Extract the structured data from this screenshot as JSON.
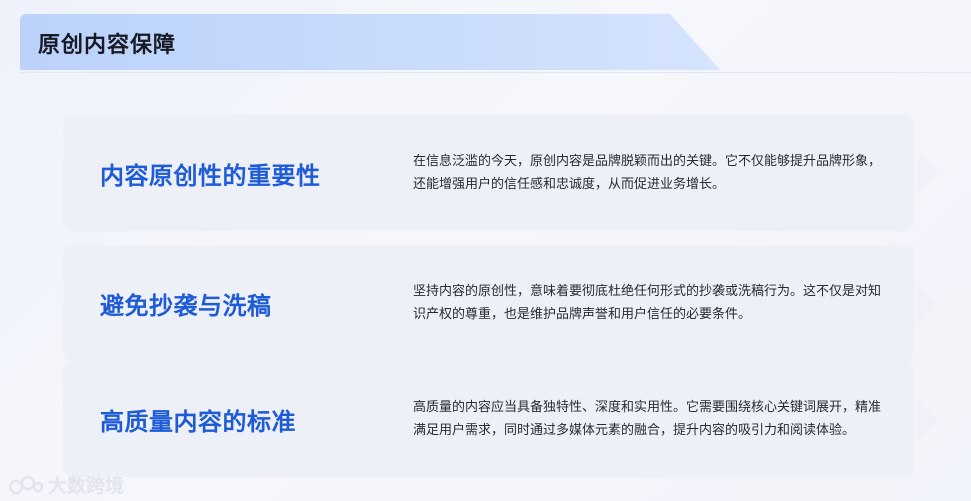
{
  "header": {
    "title": "原创内容保障"
  },
  "cards": [
    {
      "heading": "内容原创性的重要性",
      "description": "在信息泛滥的今天，原创内容是品牌脱颖而出的关键。它不仅能够提升品牌形象，还能增强用户的信任感和忠诚度，从而促进业务增长。"
    },
    {
      "heading": "避免抄袭与洗稿",
      "description": "坚持内容的原创性，意味着要彻底杜绝任何形式的抄袭或洗稿行为。这不仅是对知识产权的尊重，也是维护品牌声誉和用户信任的必要条件。"
    },
    {
      "heading": "高质量内容的标准",
      "description": "高质量的内容应当具备独特性、深度和实用性。它需要围绕核心关键词展开，精准满足用户需求，同时通过多媒体元素的融合，提升内容的吸引力和阅读体验。"
    }
  ],
  "watermark": {
    "text": "大数跨境"
  },
  "colors": {
    "accent": "#1e5bd8",
    "banner": "#c9dcfc",
    "card_bg": "#eceff6"
  }
}
